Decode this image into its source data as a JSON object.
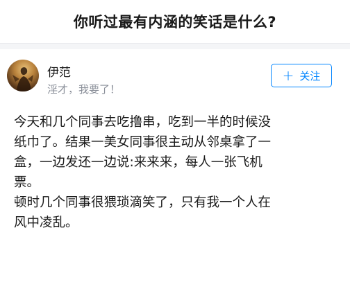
{
  "question": {
    "title": "你听过最有内涵的笑话是什么?"
  },
  "author": {
    "name": "伊范",
    "bio": "淫才，我要了！",
    "avatar": "author-avatar-image"
  },
  "follow_button": {
    "label": "关注",
    "icon": "plus-icon"
  },
  "answer": {
    "lines": [
      "今天和几个同事去吃撸串，吃到一半的时候没",
      "纸巾了。结果一美女同事很主动从邻桌拿了一",
      "盒，一边发还一边说:来来来，每人一张飞机",
      "票。",
      "顿时几个同事很猥琐滴笑了，只有我一个人在",
      "风中凌乱。"
    ]
  },
  "colors": {
    "accent": "#0084ff",
    "secondary_text": "#8a8f99",
    "separator": "#f4f5f7"
  }
}
